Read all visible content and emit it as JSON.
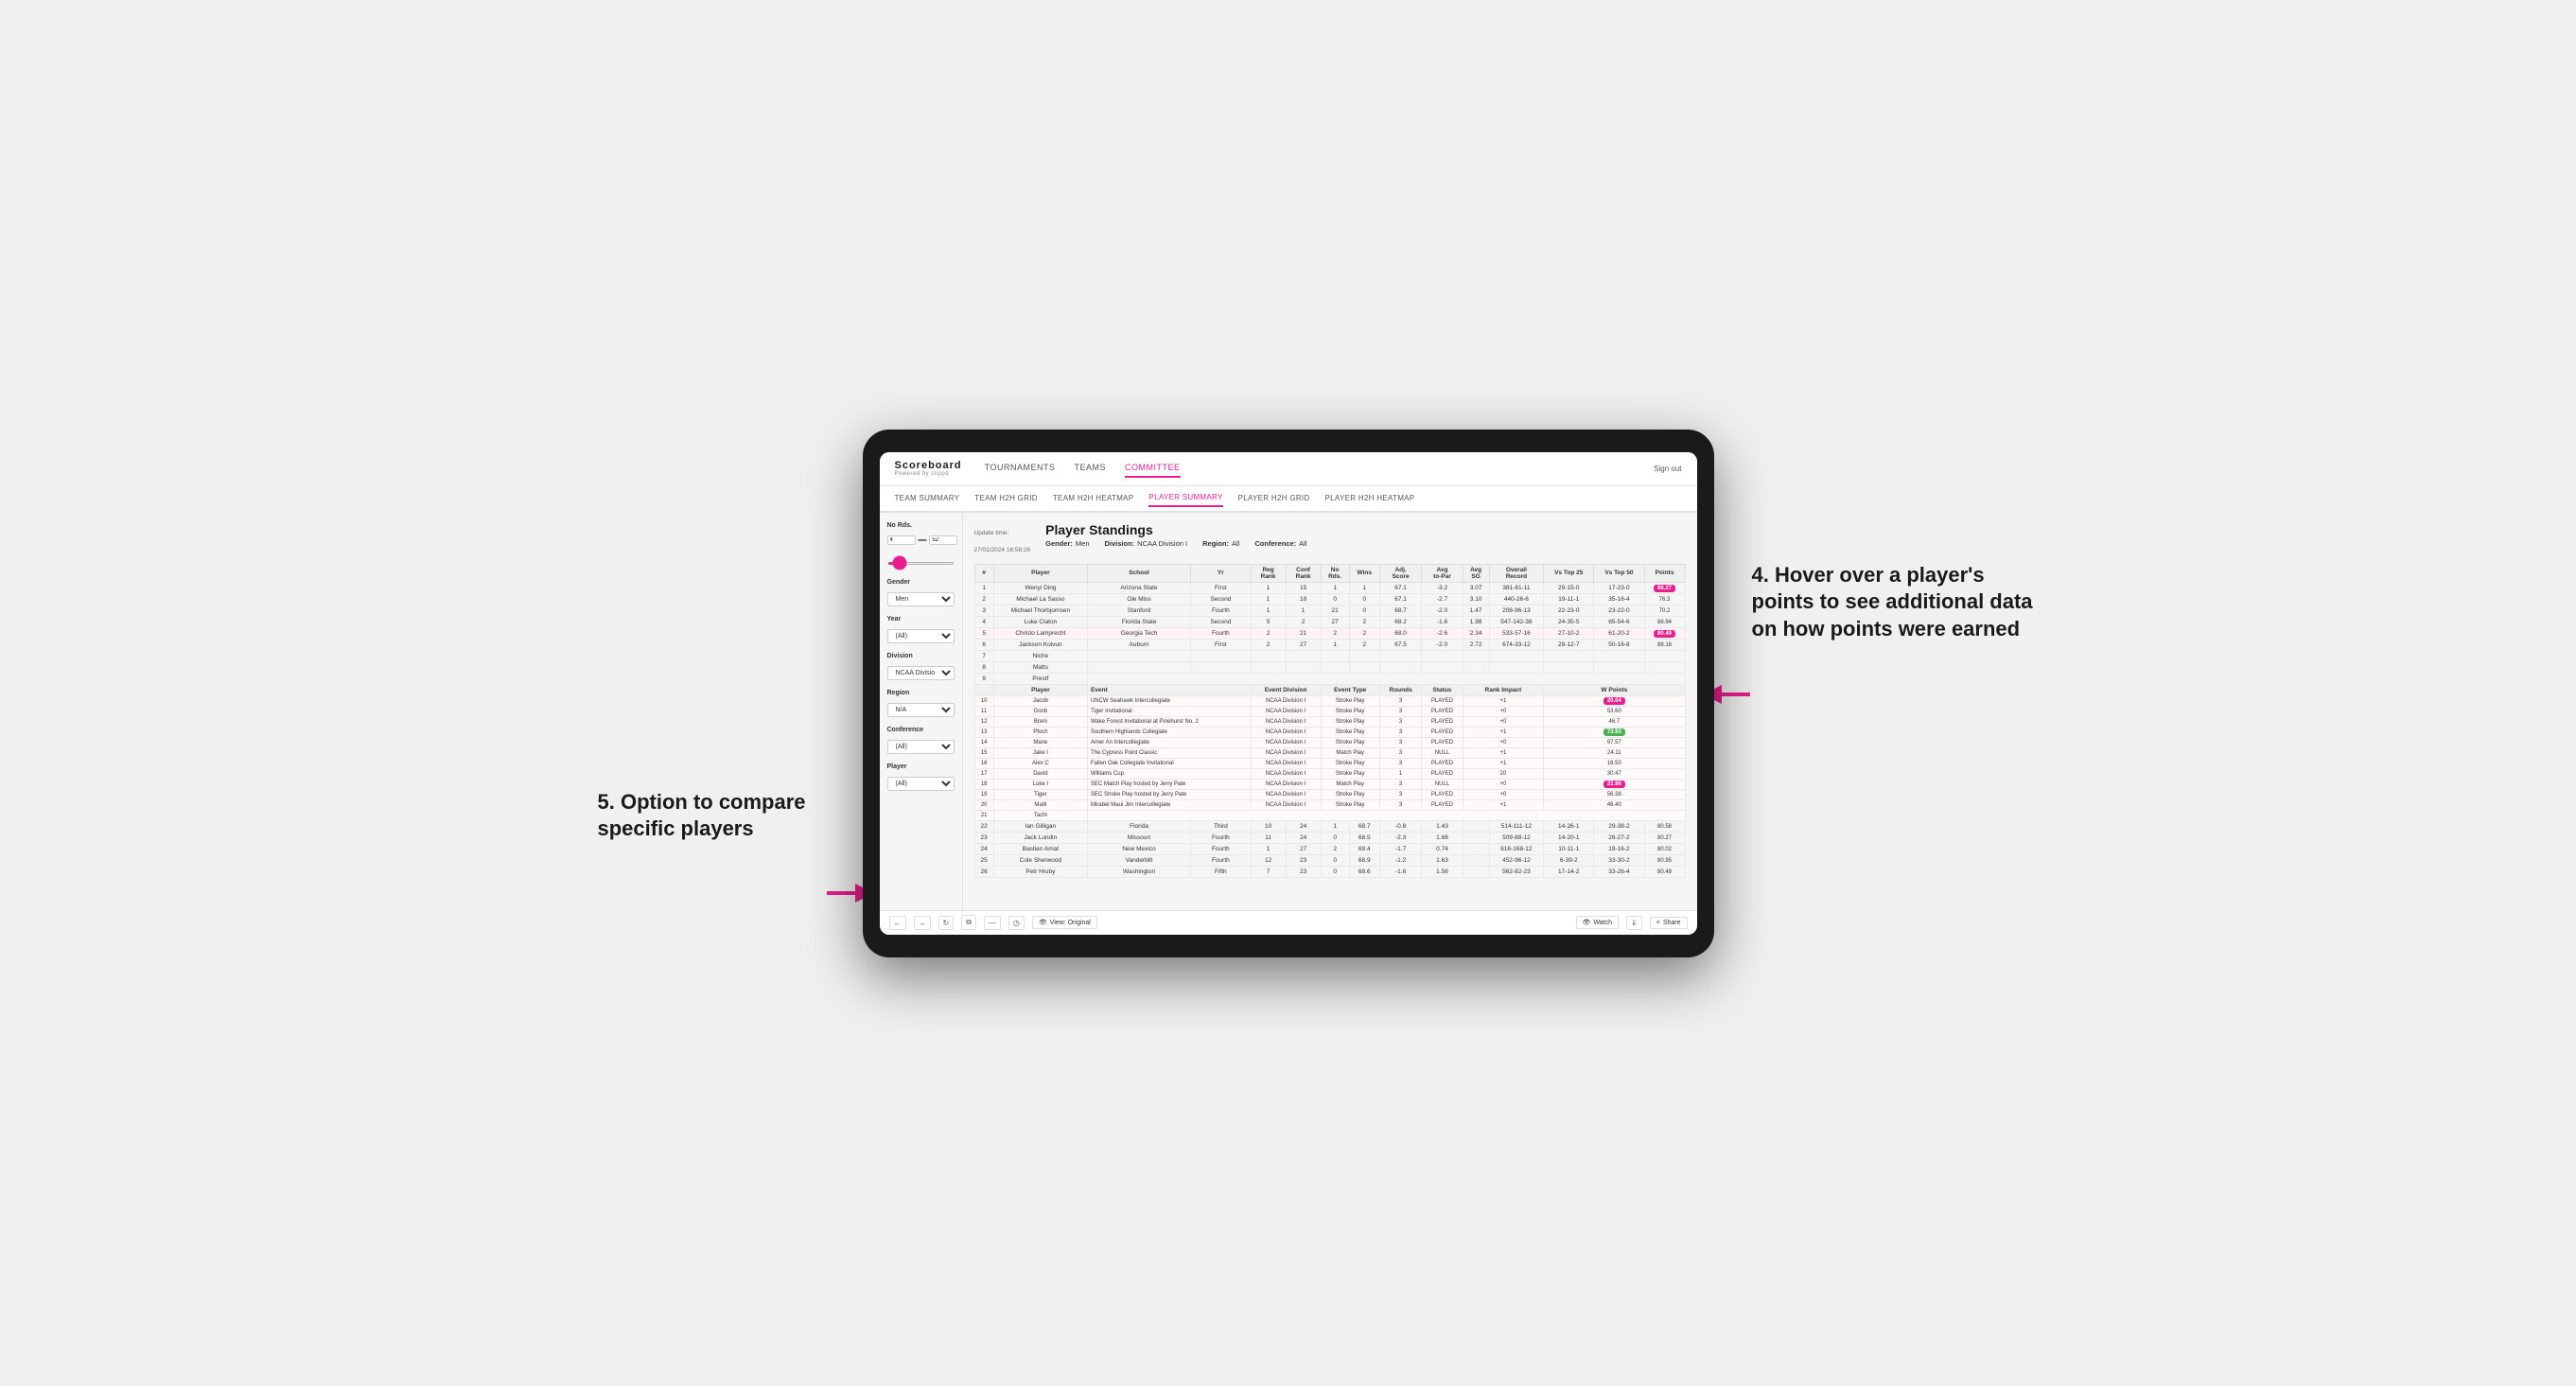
{
  "meta": {
    "title": "Scoreboard",
    "subtitle": "Powered by clippd"
  },
  "nav": {
    "links": [
      "TOURNAMENTS",
      "TEAMS",
      "COMMITTEE"
    ],
    "active": "COMMITTEE",
    "sign_out": "Sign out"
  },
  "subnav": {
    "links": [
      "TEAM SUMMARY",
      "TEAM H2H GRID",
      "TEAM H2H HEATMAP",
      "PLAYER SUMMARY",
      "PLAYER H2H GRID",
      "PLAYER H2H HEATMAP"
    ],
    "active": "PLAYER SUMMARY"
  },
  "sidebar": {
    "no_rds_label": "No Rds.",
    "no_rds_min": "4",
    "no_rds_max": "52",
    "gender_label": "Gender",
    "gender_value": "Men",
    "year_label": "Year",
    "year_value": "(All)",
    "division_label": "Division",
    "division_value": "NCAA Division I",
    "region_label": "Region",
    "region_value": "N/A",
    "conference_label": "Conference",
    "conference_value": "(All)",
    "player_label": "Player",
    "player_value": "(All)"
  },
  "content": {
    "update_time_label": "Update time:",
    "update_time_value": "27/01/2024 16:56:26",
    "title": "Player Standings",
    "filters": {
      "gender_label": "Gender:",
      "gender_value": "Men",
      "division_label": "Division:",
      "division_value": "NCAA Division I",
      "region_label": "Region:",
      "region_value": "All",
      "conference_label": "Conference:",
      "conference_value": "All"
    }
  },
  "table": {
    "headers": [
      "#",
      "Player",
      "School",
      "Yr",
      "Reg Rank",
      "Conf Rank",
      "No Rds.",
      "Wins",
      "Adj. Score",
      "Avg to-Par",
      "Avg SG",
      "Overall Record",
      "Vs Top 25",
      "Vs Top 50",
      "Points"
    ],
    "rows": [
      {
        "rank": 1,
        "player": "Wenyi Ding",
        "school": "Arizona State",
        "yr": "First",
        "reg_rank": 1,
        "conf_rank": 15,
        "no_rds": 1,
        "wins": 1,
        "adj_score": 67.1,
        "avg_topar": -3.2,
        "avg_sg": 3.07,
        "overall": "381-61-11",
        "vs25": "29-15-0",
        "vs50": "17-23-0",
        "points": "88.27",
        "points_highlight": true
      },
      {
        "rank": 2,
        "player": "Michael La Sasso",
        "school": "Ole Miss",
        "yr": "Second",
        "reg_rank": 1,
        "conf_rank": 18,
        "no_rds": 0,
        "wins": 0,
        "adj_score": 67.1,
        "avg_topar": -2.7,
        "avg_sg": 3.1,
        "overall": "440-26-6",
        "vs25": "19-11-1",
        "vs50": "35-16-4",
        "points": "76.3",
        "points_highlight": false
      },
      {
        "rank": 3,
        "player": "Michael Thorbjornsen",
        "school": "Stanford",
        "yr": "Fourth",
        "reg_rank": 1,
        "conf_rank": 1,
        "no_rds": 21,
        "wins": 0,
        "adj_score": 68.7,
        "avg_topar": -2.0,
        "avg_sg": 1.47,
        "overall": "208-96-12",
        "vs25": "22-23-0",
        "vs50": "23-22-0",
        "points": "70.2",
        "points_highlight": false
      },
      {
        "rank": 4,
        "player": "Luke Claton",
        "school": "Florida State",
        "yr": "Second",
        "reg_rank": 5,
        "conf_rank": 2,
        "no_rds": 27,
        "wins": 2,
        "adj_score": 68.2,
        "avg_topar": -1.6,
        "avg_sg": 1.98,
        "overall": "547-142-38",
        "vs25": "24-35-5",
        "vs50": "65-54-6",
        "points": "88.94",
        "points_highlight": false
      },
      {
        "rank": 5,
        "player": "Christo Lamprecht",
        "school": "Georgia Tech",
        "yr": "Fourth",
        "reg_rank": 2,
        "conf_rank": 21,
        "no_rds": 2,
        "wins": 2,
        "adj_score": 68.0,
        "avg_topar": -2.6,
        "avg_sg": 2.34,
        "overall": "533-57-16",
        "vs25": "27-10-2",
        "vs50": "61-20-2",
        "points": "80.49",
        "points_highlight": true
      },
      {
        "rank": 6,
        "player": "Jackson Koivun",
        "school": "Auburn",
        "yr": "First",
        "reg_rank": 2,
        "conf_rank": 27,
        "no_rds": 1,
        "wins": 2,
        "adj_score": 67.5,
        "avg_topar": -2.0,
        "avg_sg": 2.72,
        "overall": "674-33-12",
        "vs25": "28-12-7",
        "vs50": "50-16-8",
        "points": "88.18",
        "points_highlight": false
      },
      {
        "rank": 7,
        "player": "Niche",
        "school": "",
        "yr": "",
        "reg_rank": null,
        "conf_rank": null,
        "no_rds": null,
        "wins": null,
        "adj_score": null,
        "avg_topar": null,
        "avg_sg": null,
        "overall": "",
        "vs25": "",
        "vs50": "",
        "points": "",
        "points_highlight": false
      },
      {
        "rank": 8,
        "player": "Matts",
        "school": "",
        "yr": "",
        "reg_rank": null,
        "conf_rank": null,
        "no_rds": null,
        "wins": null,
        "adj_score": null,
        "avg_topar": null,
        "avg_sg": null,
        "overall": "",
        "vs25": "",
        "vs50": "",
        "points": "",
        "points_highlight": false
      },
      {
        "rank": 9,
        "player": "Prestf",
        "school": "",
        "yr": "",
        "reg_rank": null,
        "conf_rank": null,
        "no_rds": null,
        "wins": null,
        "adj_score": null,
        "avg_topar": null,
        "avg_sg": null,
        "overall": "",
        "vs25": "",
        "vs50": "",
        "points": "",
        "points_highlight": false
      }
    ],
    "expanded_player": "Jackson Koivun",
    "expanded_rows": [
      {
        "rank": 10,
        "player": "Jacob",
        "event": "UNCW Seahawk Intercollegiate",
        "event_div": "NCAA Division I",
        "event_type": "Stroke Play",
        "rounds": 3,
        "status": "PLAYED",
        "rank_impact": "+1",
        "w_points": "20.64"
      },
      {
        "rank": 11,
        "player": "Gonb",
        "event": "Tiger Invitational",
        "event_div": "NCAA Division I",
        "event_type": "Stroke Play",
        "rounds": 3,
        "status": "PLAYED",
        "rank_impact": "+0",
        "w_points": "53.60"
      },
      {
        "rank": 12,
        "player": "Breni",
        "event": "Wake Forest Invitational at Pinehurst No. 2",
        "event_div": "NCAA Division I",
        "event_type": "Stroke Play",
        "rounds": 3,
        "status": "PLAYED",
        "rank_impact": "+0",
        "w_points": "46.7"
      },
      {
        "rank": 13,
        "player": "Pfoch",
        "event": "Southern Highlands Collegiate",
        "event_div": "NCAA Division I",
        "event_type": "Stroke Play",
        "rounds": 3,
        "status": "PLAYED",
        "rank_impact": "+1",
        "w_points": "73.93"
      },
      {
        "rank": 14,
        "player": "Marie",
        "event": "Amer An Intercollegiate",
        "event_div": "NCAA Division I",
        "event_type": "Stroke Play",
        "rounds": 3,
        "status": "PLAYED",
        "rank_impact": "+0",
        "w_points": "97.57"
      },
      {
        "rank": 15,
        "player": "Jake I",
        "event": "The Cypress Point Classic",
        "event_div": "NCAA Division I",
        "event_type": "Match Play",
        "rounds": 3,
        "status": "NULL",
        "rank_impact": "+1",
        "w_points": "24.11"
      },
      {
        "rank": 16,
        "player": "Alex C",
        "event": "Fallen Oak Collegiate Invitational",
        "event_div": "NCAA Division I",
        "event_type": "Stroke Play",
        "rounds": 3,
        "status": "PLAYED",
        "rank_impact": "+1",
        "w_points": "16.50"
      },
      {
        "rank": 17,
        "player": "David",
        "event": "Williams Cup",
        "event_div": "NCAA Division I",
        "event_type": "Stroke Play",
        "rounds": 1,
        "status": "PLAYED",
        "rank_impact": "20",
        "w_points": "30.47"
      },
      {
        "rank": 18,
        "player": "Luke I",
        "event": "SEC Match Play hosted by Jerry Pate",
        "event_div": "NCAA Division I",
        "event_type": "Match Play",
        "rounds": 3,
        "status": "NULL",
        "rank_impact": "+0",
        "w_points": "23.98"
      },
      {
        "rank": 19,
        "player": "Tiger",
        "event": "SEC Stroke Play hosted by Jerry Pate",
        "event_div": "NCAA Division I",
        "event_type": "Stroke Play",
        "rounds": 3,
        "status": "PLAYED",
        "rank_impact": "+0",
        "w_points": "56.38"
      },
      {
        "rank": 20,
        "player": "Mattl",
        "event": "Mirabel Maui Jim Intercollegiate",
        "event_div": "NCAA Division I",
        "event_type": "Stroke Play",
        "rounds": 3,
        "status": "PLAYED",
        "rank_impact": "+1",
        "w_points": "46.40"
      },
      {
        "rank": 21,
        "player": "Tachi",
        "event": "",
        "event_div": "",
        "event_type": "",
        "rounds": null,
        "status": "",
        "rank_impact": "",
        "w_points": ""
      }
    ],
    "lower_rows": [
      {
        "rank": 22,
        "player": "Ian Gilligan",
        "school": "Florida",
        "yr": "Third",
        "reg_rank": 10,
        "conf_rank": 24,
        "no_rds": 1,
        "wins": 68.7,
        "adj_score": -0.8,
        "avg_topar": 1.43,
        "avg_sg": null,
        "overall": "514-111-12",
        "vs25": "14-26-1",
        "vs50": "29-38-2",
        "points": "80.58",
        "points_highlight": false
      },
      {
        "rank": 23,
        "player": "Jack Lundin",
        "school": "Missouri",
        "yr": "Fourth",
        "reg_rank": 11,
        "conf_rank": 24,
        "no_rds": 0,
        "wins": 68.5,
        "adj_score": -2.3,
        "avg_topar": 1.68,
        "avg_sg": null,
        "overall": "509-88-12",
        "vs25": "14-20-1",
        "vs50": "26-27-2",
        "points": "80.27",
        "points_highlight": false
      },
      {
        "rank": 24,
        "player": "Bastien Amat",
        "school": "New Mexico",
        "yr": "Fourth",
        "reg_rank": 1,
        "conf_rank": 27,
        "no_rds": 2,
        "wins": 69.4,
        "adj_score": -1.7,
        "avg_topar": 0.74,
        "avg_sg": null,
        "overall": "616-168-12",
        "vs25": "10-11-1",
        "vs50": "19-16-2",
        "points": "80.02",
        "points_highlight": false
      },
      {
        "rank": 25,
        "player": "Cole Sherwood",
        "school": "Vanderbilt",
        "yr": "Fourth",
        "reg_rank": 12,
        "conf_rank": 23,
        "no_rds": 0,
        "wins": 68.9,
        "adj_score": -1.2,
        "avg_topar": 1.63,
        "avg_sg": null,
        "overall": "452-96-12",
        "vs25": "6-39-2",
        "vs50": "33-30-2",
        "points": "80.95",
        "points_highlight": false
      },
      {
        "rank": 26,
        "player": "Petr Hruby",
        "school": "Washington",
        "yr": "Fifth",
        "reg_rank": 7,
        "conf_rank": 23,
        "no_rds": 0,
        "wins": 68.6,
        "adj_score": -1.6,
        "avg_topar": 1.56,
        "avg_sg": null,
        "overall": "562-82-23",
        "vs25": "17-14-2",
        "vs50": "33-26-4",
        "points": "80.49",
        "points_highlight": false
      }
    ]
  },
  "toolbar": {
    "back": "←",
    "forward": "→",
    "refresh": "⟳",
    "copy": "⧉",
    "dash": "—",
    "clock": "⏱",
    "view_label": "View: Original",
    "watch_label": "Watch",
    "download_label": "↓",
    "share_label": "Share"
  },
  "annotations": {
    "right_text": "4. Hover over a player's points to see additional data on how points were earned",
    "left_text": "5. Option to compare specific players"
  }
}
